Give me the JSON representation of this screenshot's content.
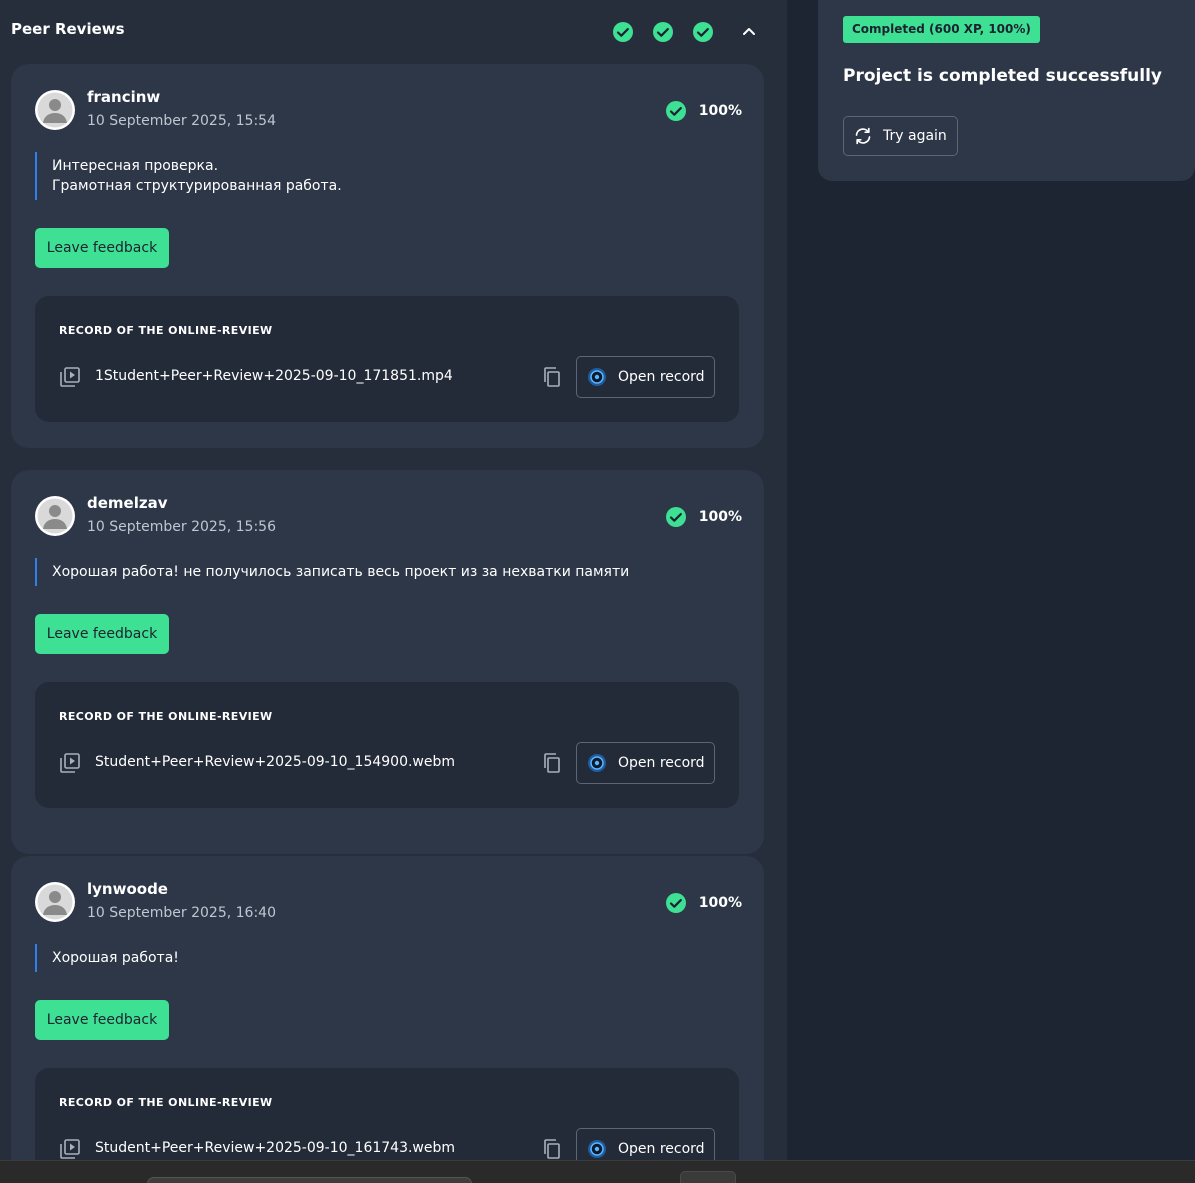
{
  "peer_reviews": {
    "title": "Peer Reviews",
    "summary_check_icons": [
      "check-circle-icon",
      "check-circle-icon",
      "check-circle-icon"
    ],
    "collapse_icon": "chevron-up-icon"
  },
  "reviews": [
    {
      "name": "francinw",
      "date": "10 September 2025, 15:54",
      "score": "100%",
      "comment_lines": [
        "Интересная проверка.",
        "Грамотная структурированная работа."
      ],
      "feedback_label": "Leave feedback",
      "record_heading": "RECORD OF THE ONLINE-REVIEW",
      "file_name": "1Student+Peer+Review+2025-09-10_171851.mp4",
      "open_label": "Open record"
    },
    {
      "name": "demelzav",
      "date": "10 September 2025, 15:56",
      "score": "100%",
      "comment_lines": [
        "Хорошая работа! не получилось записать весь проект из за нехватки памяти"
      ],
      "feedback_label": "Leave feedback",
      "record_heading": "RECORD OF THE ONLINE-REVIEW",
      "file_name": "Student+Peer+Review+2025-09-10_154900.webm",
      "open_label": "Open record"
    },
    {
      "name": "lynwoode",
      "date": "10 September 2025, 16:40",
      "score": "100%",
      "comment_lines": [
        "Хорошая работа!"
      ],
      "feedback_label": "Leave feedback",
      "record_heading": "RECORD OF THE ONLINE-REVIEW",
      "file_name": "Student+Peer+Review+2025-09-10_161743.webm",
      "open_label": "Open record"
    }
  ],
  "status_panel": {
    "badge": "Completed (600 XP, 100%)",
    "title": "Project is completed successfully",
    "try_again_label": "Try again"
  },
  "colors": {
    "accent_green": "#3ee094",
    "comment_bar_blue": "#2f80ed",
    "card_bg": "#2d3748",
    "page_bg": "#1e2532"
  }
}
